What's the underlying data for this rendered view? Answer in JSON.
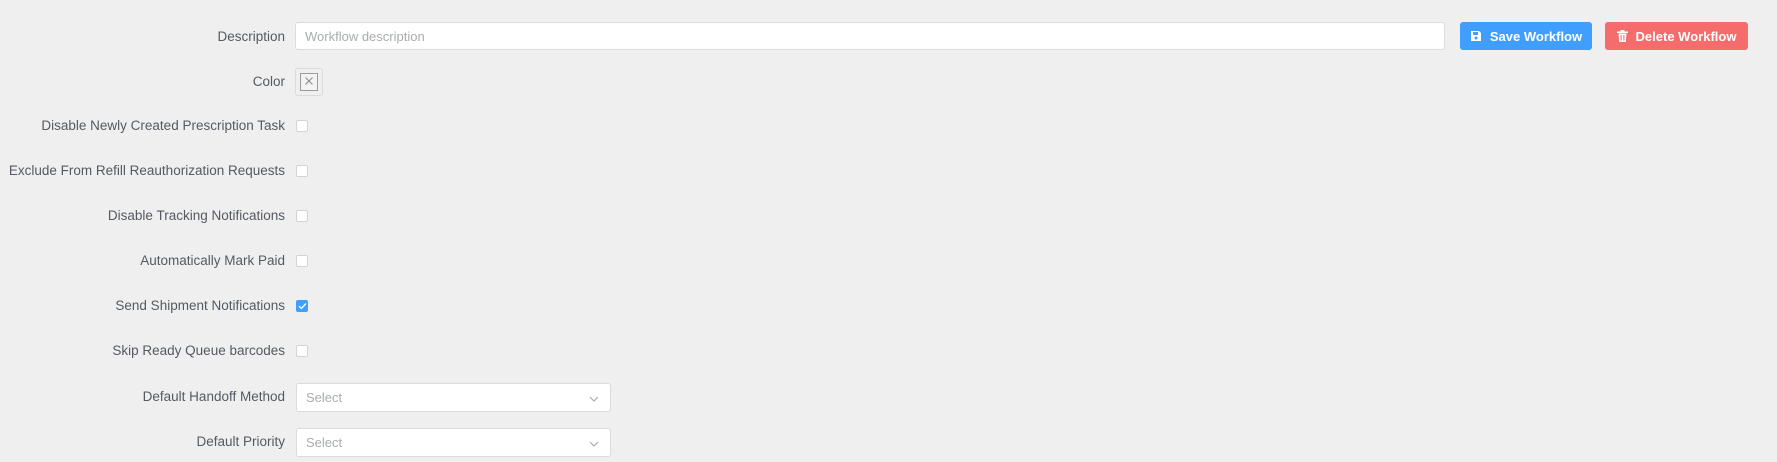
{
  "fields": {
    "description": {
      "label": "Description",
      "placeholder": "Workflow description",
      "value": ""
    },
    "color": {
      "label": "Color",
      "value": null,
      "icon": "close-icon"
    },
    "checkboxes": [
      {
        "label": "Disable Newly Created Prescription Task",
        "checked": false
      },
      {
        "label": "Exclude From Refill Reauthorization Requests",
        "checked": false
      },
      {
        "label": "Disable Tracking Notifications",
        "checked": false
      },
      {
        "label": "Automatically Mark Paid",
        "checked": false
      },
      {
        "label": "Send Shipment Notifications",
        "checked": true
      },
      {
        "label": "Skip Ready Queue barcodes",
        "checked": false
      }
    ],
    "default_handoff_method": {
      "label": "Default Handoff Method",
      "placeholder": "Select",
      "icon": "chevron-down-icon"
    },
    "default_priority": {
      "label": "Default Priority",
      "placeholder": "Select",
      "icon": "chevron-down-icon"
    }
  },
  "actions": {
    "save_label": "Save Workflow",
    "save_icon": "save-icon",
    "save_color": "#409eff",
    "delete_label": "Delete Workflow",
    "delete_icon": "trash-icon",
    "delete_color": "#f56c6c"
  },
  "colors": {
    "background": "#efefef",
    "checked": "#409eff"
  }
}
